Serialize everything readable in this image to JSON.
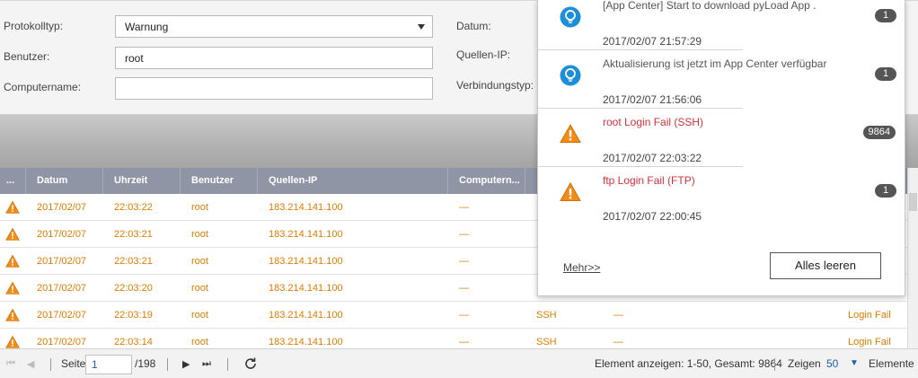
{
  "filter": {
    "log_type_label": "Protokolltyp:",
    "log_type_value": "Warnung",
    "user_label": "Benutzer:",
    "user_value": "root",
    "computer_label": "Computername:",
    "computer_value": "",
    "date_label": "Datum:",
    "source_ip_label": "Quellen-IP:",
    "connection_label": "Verbindungstyp:"
  },
  "table": {
    "columns": [
      "...",
      "Datum",
      "Uhrzeit",
      "Benutzer",
      "Quellen-IP",
      "Computern..."
    ],
    "rows": [
      {
        "date": "2017/02/07",
        "time": "22:03:22",
        "user": "root",
        "ip": "183.214.141.100",
        "computer": "—",
        "protocol": "",
        "resource": "",
        "action": ""
      },
      {
        "date": "2017/02/07",
        "time": "22:03:21",
        "user": "root",
        "ip": "183.214.141.100",
        "computer": "—",
        "protocol": "",
        "resource": "",
        "action": ""
      },
      {
        "date": "2017/02/07",
        "time": "22:03:21",
        "user": "root",
        "ip": "183.214.141.100",
        "computer": "—",
        "protocol": "",
        "resource": "",
        "action": ""
      },
      {
        "date": "2017/02/07",
        "time": "22:03:20",
        "user": "root",
        "ip": "183.214.141.100",
        "computer": "—",
        "protocol": "",
        "resource": "",
        "action": ""
      },
      {
        "date": "2017/02/07",
        "time": "22:03:19",
        "user": "root",
        "ip": "183.214.141.100",
        "computer": "—",
        "protocol": "SSH",
        "resource": "—",
        "action": "Login Fail"
      },
      {
        "date": "2017/02/07",
        "time": "22:03:14",
        "user": "root",
        "ip": "183.214.141.100",
        "computer": "—",
        "protocol": "SSH",
        "resource": "—",
        "action": "Login Fail"
      }
    ]
  },
  "footer": {
    "page_label": "Seite",
    "page_value": "1",
    "page_total": "/198",
    "display_info": "Element anzeigen: 1-50, Gesamt: 9864",
    "show_label": "Zeigen",
    "show_value": "50",
    "items_label": "Elemente"
  },
  "notifications": {
    "items": [
      {
        "title": "[App Center] Start to download pyLoad App .",
        "time": "2017/02/07 21:57:29",
        "count": "1",
        "icon": "lightbulb-icon"
      },
      {
        "title": "Aktualisierung ist jetzt im App Center verfügbar",
        "time": "2017/02/07 21:56:06",
        "count": "1",
        "icon": "lightbulb-icon"
      },
      {
        "title": "root Login Fail (SSH)",
        "time": "2017/02/07 22:03:22",
        "count": "9864",
        "icon": "warning-icon"
      },
      {
        "title": "ftp Login Fail (FTP)",
        "time": "2017/02/07 22:00:45",
        "count": "1",
        "icon": "warning-icon"
      }
    ],
    "more_label": "Mehr>>",
    "clear_label": "Alles leeren"
  },
  "colors": {
    "warning_text": "#e07c00",
    "error_text": "#d2323c",
    "header_bg": "#8f95a5",
    "info_blue": "#1d8fd8"
  }
}
